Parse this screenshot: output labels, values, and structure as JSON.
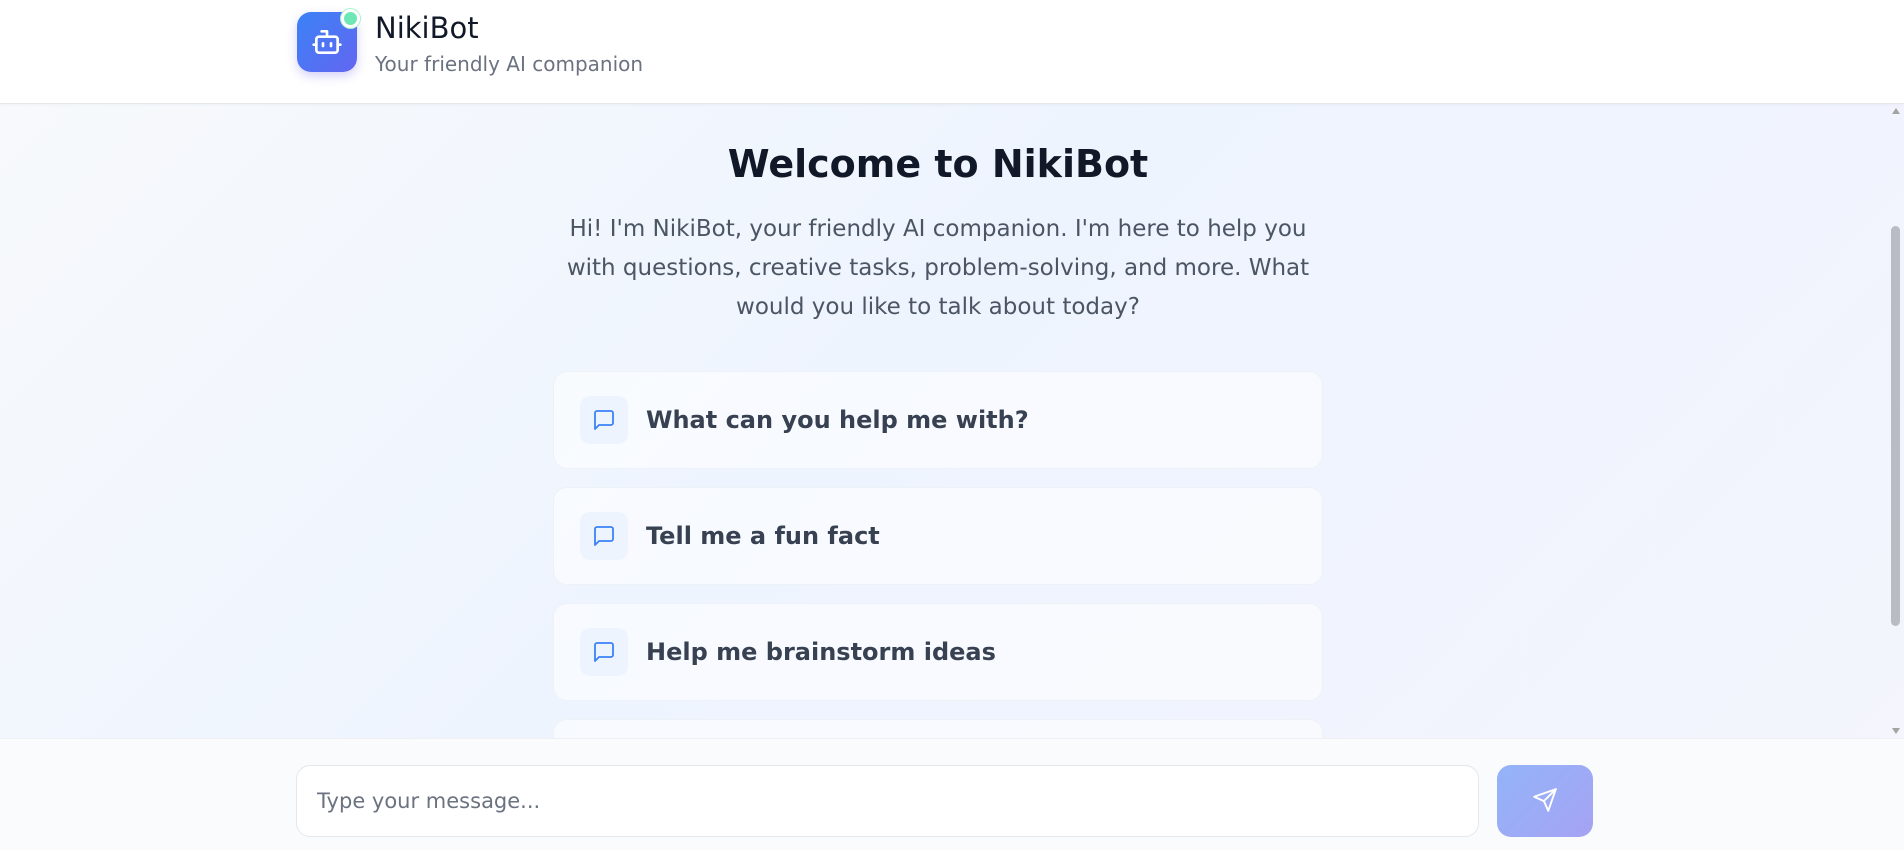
{
  "header": {
    "title": "NikiBot",
    "subtitle": "Your friendly AI companion",
    "status": "online",
    "brand_gradient": [
      "#3b82f6",
      "#6366f1"
    ],
    "status_color": "#6ee7b7"
  },
  "welcome": {
    "title": "Welcome to NikiBot",
    "text": "Hi! I'm NikiBot, your friendly AI companion. I'm here to help you with questions, creative tasks, problem-solving, and more. What would you like to talk about today?"
  },
  "suggestions": [
    {
      "label": "What can you help me with?",
      "icon": "message-square-icon"
    },
    {
      "label": "Tell me a fun fact",
      "icon": "message-square-icon"
    },
    {
      "label": "Help me brainstorm ideas",
      "icon": "message-square-icon"
    }
  ],
  "composer": {
    "placeholder": "Type your message...",
    "value": "",
    "send_icon": "send-icon"
  },
  "colors": {
    "accent": "#3b82f6",
    "text_primary": "#111827",
    "text_secondary": "#4b5563"
  }
}
